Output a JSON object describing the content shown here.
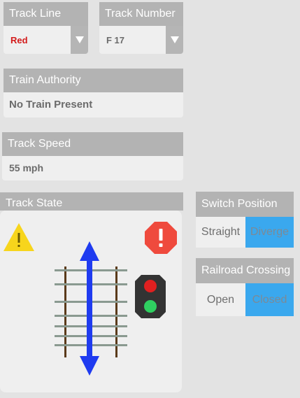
{
  "track_line": {
    "label": "Track Line",
    "value": "Red",
    "value_color": "#d31a1a"
  },
  "track_number": {
    "label": "Track Number",
    "value": "F 17"
  },
  "train_authority": {
    "label": "Train Authority",
    "value": "No Train Present"
  },
  "track_speed": {
    "label": "Track Speed",
    "value": "55 mph"
  },
  "track_state": {
    "label": "Track State",
    "warning_icon": "warning-triangle-icon",
    "alert_icon": "stop-alert-icon",
    "signal_icon": "traffic-signal-icon",
    "arrow_color": "#1f3bf0"
  },
  "switch_position": {
    "label": "Switch Position",
    "options": [
      "Straight",
      "Diverge"
    ],
    "selected": "Diverge"
  },
  "railroad_crossing": {
    "label": "Railroad Crossing",
    "options": [
      "Open",
      "Closed"
    ],
    "selected": "Closed"
  },
  "colors": {
    "header": "#b3b3b3",
    "panel": "#efefef",
    "toggle_active": "#3aa8ee",
    "warning_yellow": "#f7d51c",
    "alert_red": "#ef4a3d"
  }
}
